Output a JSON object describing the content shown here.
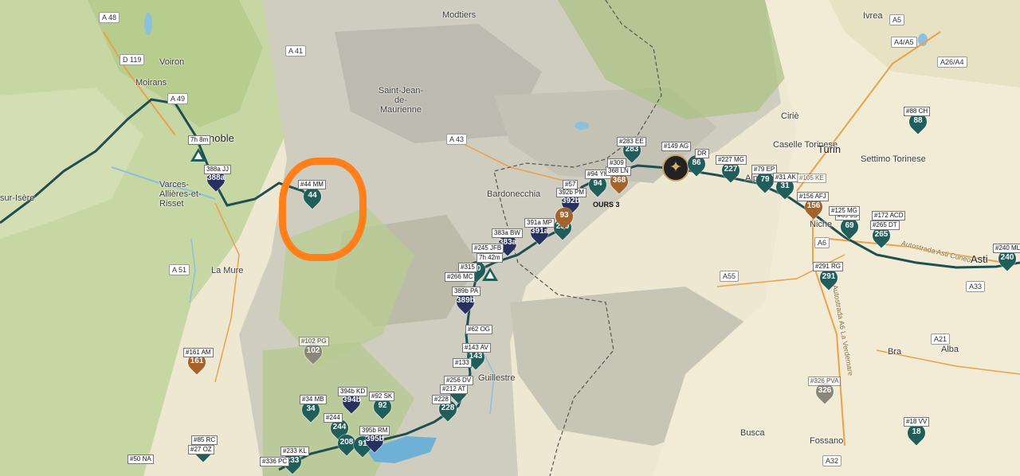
{
  "places": [
    "Moirans",
    "Voiron",
    "Saint-Jean-de-Maurienne",
    "Modtiers",
    "Ivrea",
    "Ciriè",
    "Caselle Torinese",
    "Settimo Torinese",
    "Bardonecchia",
    "La Mure",
    "Varces-Allières-et-Risset",
    "Turin",
    "Guillestre",
    "Bra",
    "Alba",
    "Busca",
    "Fossano",
    "Asti",
    "sur-Isère",
    "noble",
    "Niche",
    "Alp"
  ],
  "roads": [
    "A 48",
    "D 119",
    "A 49",
    "A 41",
    "A 43",
    "A 51",
    "A5",
    "A4/A5",
    "A26/A4",
    "A6",
    "A55",
    "A33",
    "A21",
    "A32"
  ],
  "road_labels": [
    "Autostrada Asti Cuneo",
    "Autostrada A6 La Verdemare"
  ],
  "teal_pins": [
    {
      "num": "44",
      "label": "#44 MM"
    },
    {
      "num": "283",
      "label": "#283 EE"
    },
    {
      "num": "94",
      "label": "#94 YH"
    },
    {
      "num": "86",
      "label": ""
    },
    {
      "num": "227",
      "label": "#227 MG"
    },
    {
      "num": "79",
      "label": "#79 EP"
    },
    {
      "num": "31",
      "label": "#31 AK"
    },
    {
      "num": "69",
      "label": "#69 JS"
    },
    {
      "num": "265",
      "label": "#265 DT"
    },
    {
      "num": "88",
      "label": "#88 CH"
    },
    {
      "num": "291",
      "label": "#291 RG"
    },
    {
      "num": "240",
      "label": "#240 ML"
    },
    {
      "num": "18",
      "label": "#18 VV"
    },
    {
      "num": "40",
      "label": "#266 MC"
    },
    {
      "num": "143",
      "label": "#143 AV"
    },
    {
      "num": "256",
      "label": "#256 DV"
    },
    {
      "num": "228",
      "label": "#228"
    },
    {
      "num": "34",
      "label": "#34 MB"
    },
    {
      "num": "244",
      "label": "#244"
    },
    {
      "num": "208",
      "label": ""
    },
    {
      "num": "91",
      "label": ""
    },
    {
      "num": "92",
      "label": "#92 SK"
    },
    {
      "num": "85",
      "label": "#85 RC"
    },
    {
      "num": "233",
      "label": "#233 KL"
    },
    {
      "num": "230",
      "label": ""
    }
  ],
  "navy_pins": [
    {
      "num": "388a",
      "label": "388a JJ"
    },
    {
      "num": "392b",
      "label": "392b PM"
    },
    {
      "num": "391a",
      "label": "391a MP"
    },
    {
      "num": "383a",
      "label": "383a BW"
    },
    {
      "num": "389b",
      "label": "389b PA"
    },
    {
      "num": "394b",
      "label": "394b KD"
    },
    {
      "num": "395b",
      "label": "395b RM"
    }
  ],
  "brown_pins": [
    {
      "num": "368",
      "label": "368 LN"
    },
    {
      "num": "156",
      "label": "#156 AFJ"
    },
    {
      "num": "161",
      "label": "#161 AM"
    },
    {
      "num": "93",
      "label": ""
    }
  ],
  "grey_pins": [
    {
      "num": "102",
      "label": "#102 PG"
    },
    {
      "num": "326",
      "label": "#326 PVA"
    }
  ],
  "extra_labels": [
    "7h 8m",
    "#149 AG",
    "#309",
    "#57",
    "#245 JFB",
    "7h 42m",
    "#315",
    "#62 OG",
    "#133",
    "#212 AT",
    "#336 PC",
    "#50 NA",
    "#27 OZ",
    "#105 KE",
    "#172 ACD",
    "#125 MG",
    "DR"
  ],
  "bold_labels": [
    "OURS 3"
  ],
  "colors": {
    "teal": "#1f5e5b",
    "navy": "#27315f",
    "brown": "#a5622b",
    "grey": "#8a877a",
    "route": "#1e4f52",
    "highlight": "#ff7f1a"
  }
}
